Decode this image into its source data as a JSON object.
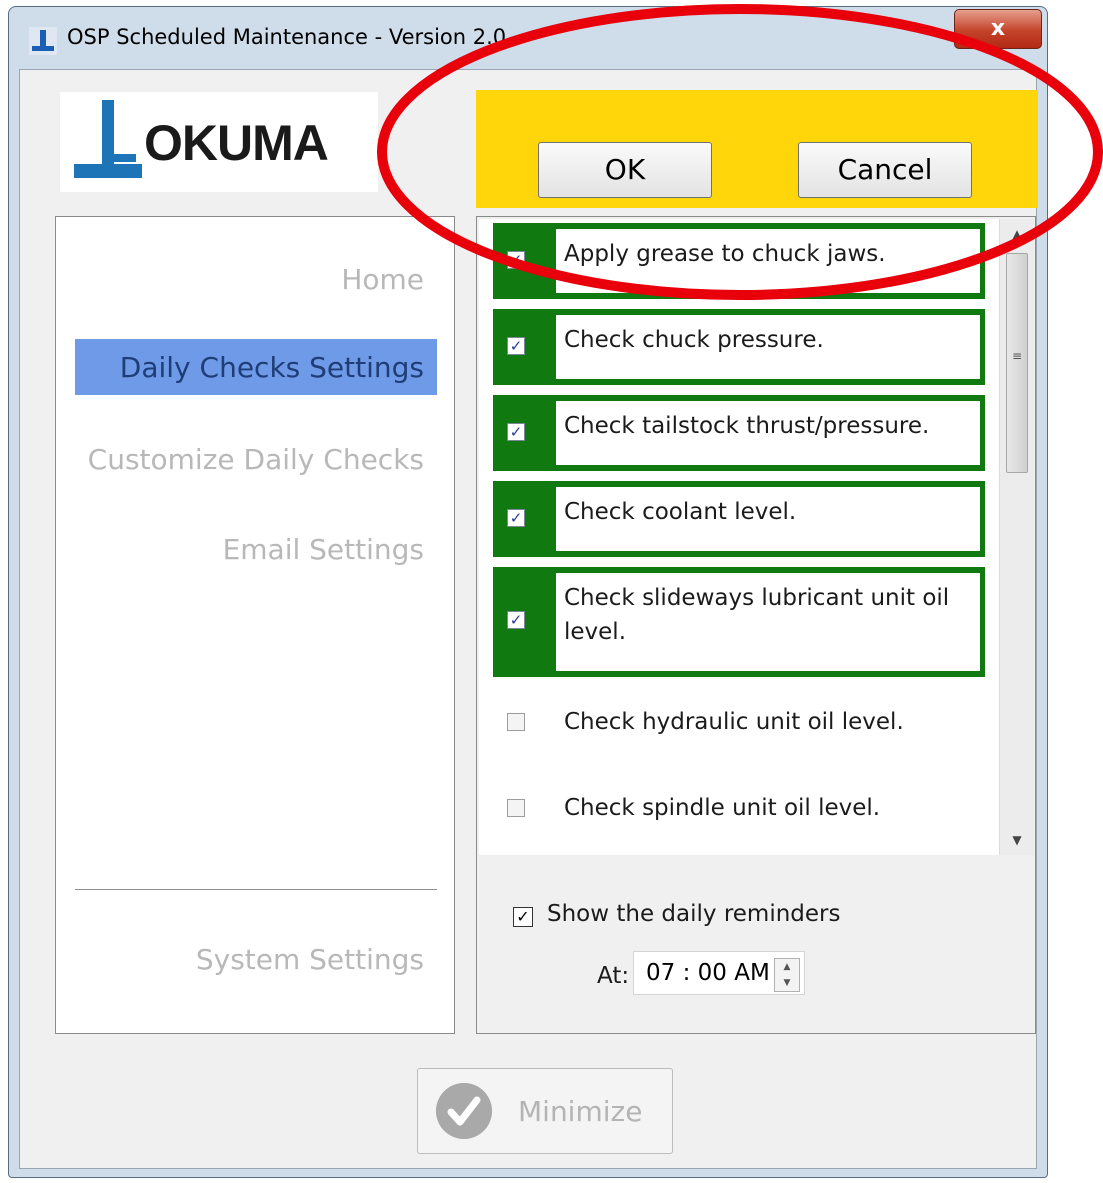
{
  "window": {
    "title": "OSP Scheduled Maintenance - Version 2.0",
    "close_label": "x"
  },
  "logo": {
    "text": "OKUMA"
  },
  "nav": {
    "items": [
      {
        "label": "Home",
        "active": false
      },
      {
        "label": "Daily Checks Settings",
        "active": true
      },
      {
        "label": "Customize Daily Checks",
        "active": false
      },
      {
        "label": "Email Settings",
        "active": false
      }
    ],
    "bottom_item": "System Settings"
  },
  "actions": {
    "ok_label": "OK",
    "cancel_label": "Cancel"
  },
  "checks": [
    {
      "label": "Apply grease to chuck jaws.",
      "checked": true
    },
    {
      "label": "Check chuck pressure.",
      "checked": true
    },
    {
      "label": "Check tailstock thrust/pressure.",
      "checked": true
    },
    {
      "label": "Check coolant level.",
      "checked": true
    },
    {
      "label": "Check slideways lubricant unit oil level.",
      "checked": true
    },
    {
      "label": "Check hydraulic unit oil level.",
      "checked": false
    },
    {
      "label": "Check spindle unit oil level.",
      "checked": false
    }
  ],
  "reminder": {
    "show_label": "Show the daily reminders",
    "show_checked": true,
    "at_label": "At:",
    "time_value": "07 : 00 AM"
  },
  "minimize": {
    "label": "Minimize"
  },
  "colors": {
    "checked_item": "#10790f",
    "header_bar": "#ffd60a",
    "nav_active": "#6e9ae8",
    "annotation": "#e8000b"
  }
}
